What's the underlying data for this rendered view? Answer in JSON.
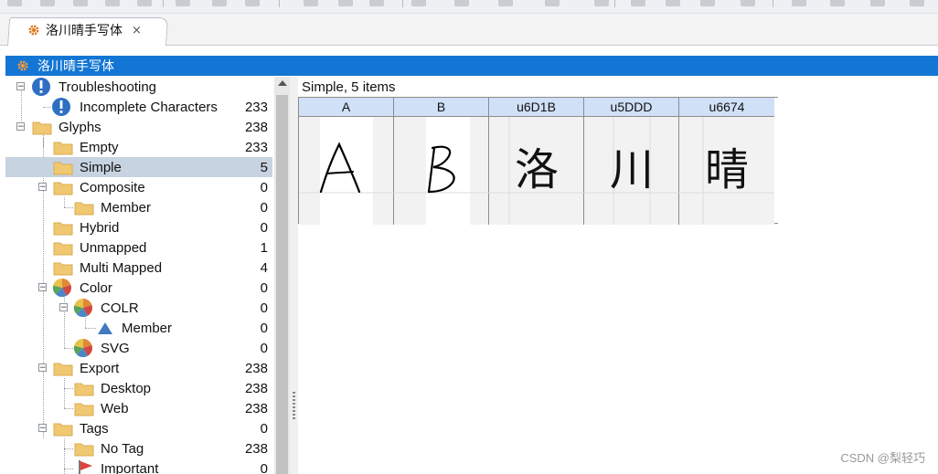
{
  "document_tab": {
    "title": "洛川晴手写体",
    "icon": "gear-icon",
    "close_icon": "close-icon"
  },
  "document_bar": {
    "title": "洛川晴手写体",
    "icon": "gear-icon"
  },
  "tree": {
    "rows": [
      {
        "label": "Troubleshooting",
        "count": "",
        "icon": "warning-info-icon",
        "expanded": true
      },
      {
        "label": "Incomplete Characters",
        "count": "233",
        "icon": "warning-info-icon"
      },
      {
        "label": "Glyphs",
        "count": "238",
        "icon": "folder-icon",
        "expanded": true
      },
      {
        "label": "Empty",
        "count": "233",
        "icon": "folder-icon"
      },
      {
        "label": "Simple",
        "count": "5",
        "icon": "folder-icon",
        "selected": true
      },
      {
        "label": "Composite",
        "count": "0",
        "icon": "folder-icon",
        "expanded": true
      },
      {
        "label": "Member",
        "count": "0",
        "icon": "folder-icon"
      },
      {
        "label": "Hybrid",
        "count": "0",
        "icon": "folder-icon"
      },
      {
        "label": "Unmapped",
        "count": "1",
        "icon": "folder-icon"
      },
      {
        "label": "Multi Mapped",
        "count": "4",
        "icon": "folder-icon"
      },
      {
        "label": "Color",
        "count": "0",
        "icon": "pie-color-icon",
        "expanded": true
      },
      {
        "label": "COLR",
        "count": "0",
        "icon": "pie-color-icon",
        "expanded": true
      },
      {
        "label": "Member",
        "count": "0",
        "icon": "triangle-icon"
      },
      {
        "label": "SVG",
        "count": "0",
        "icon": "pie-color-icon"
      },
      {
        "label": "Export",
        "count": "238",
        "icon": "folder-icon",
        "expanded": true
      },
      {
        "label": "Desktop",
        "count": "238",
        "icon": "folder-icon"
      },
      {
        "label": "Web",
        "count": "238",
        "icon": "folder-icon"
      },
      {
        "label": "Tags",
        "count": "0",
        "icon": "folder-icon",
        "expanded": true
      },
      {
        "label": "No Tag",
        "count": "238",
        "icon": "folder-icon"
      },
      {
        "label": "Important",
        "count": "0",
        "icon": "flag-icon"
      }
    ]
  },
  "glyph_pane": {
    "title": "Simple, 5 items",
    "glyphs": [
      {
        "name": "A",
        "glyph": "A"
      },
      {
        "name": "B",
        "glyph": "B"
      },
      {
        "name": "u6D1B",
        "glyph": "洛"
      },
      {
        "name": "u5DDD",
        "glyph": "川"
      },
      {
        "name": "u6674",
        "glyph": "晴"
      }
    ]
  },
  "watermark": "CSDN @梨轻巧",
  "colors": {
    "accent_blue": "#1476d4",
    "selection": "#c8d3e1",
    "folder": "#f0c872",
    "header": "#cfe0f7"
  }
}
